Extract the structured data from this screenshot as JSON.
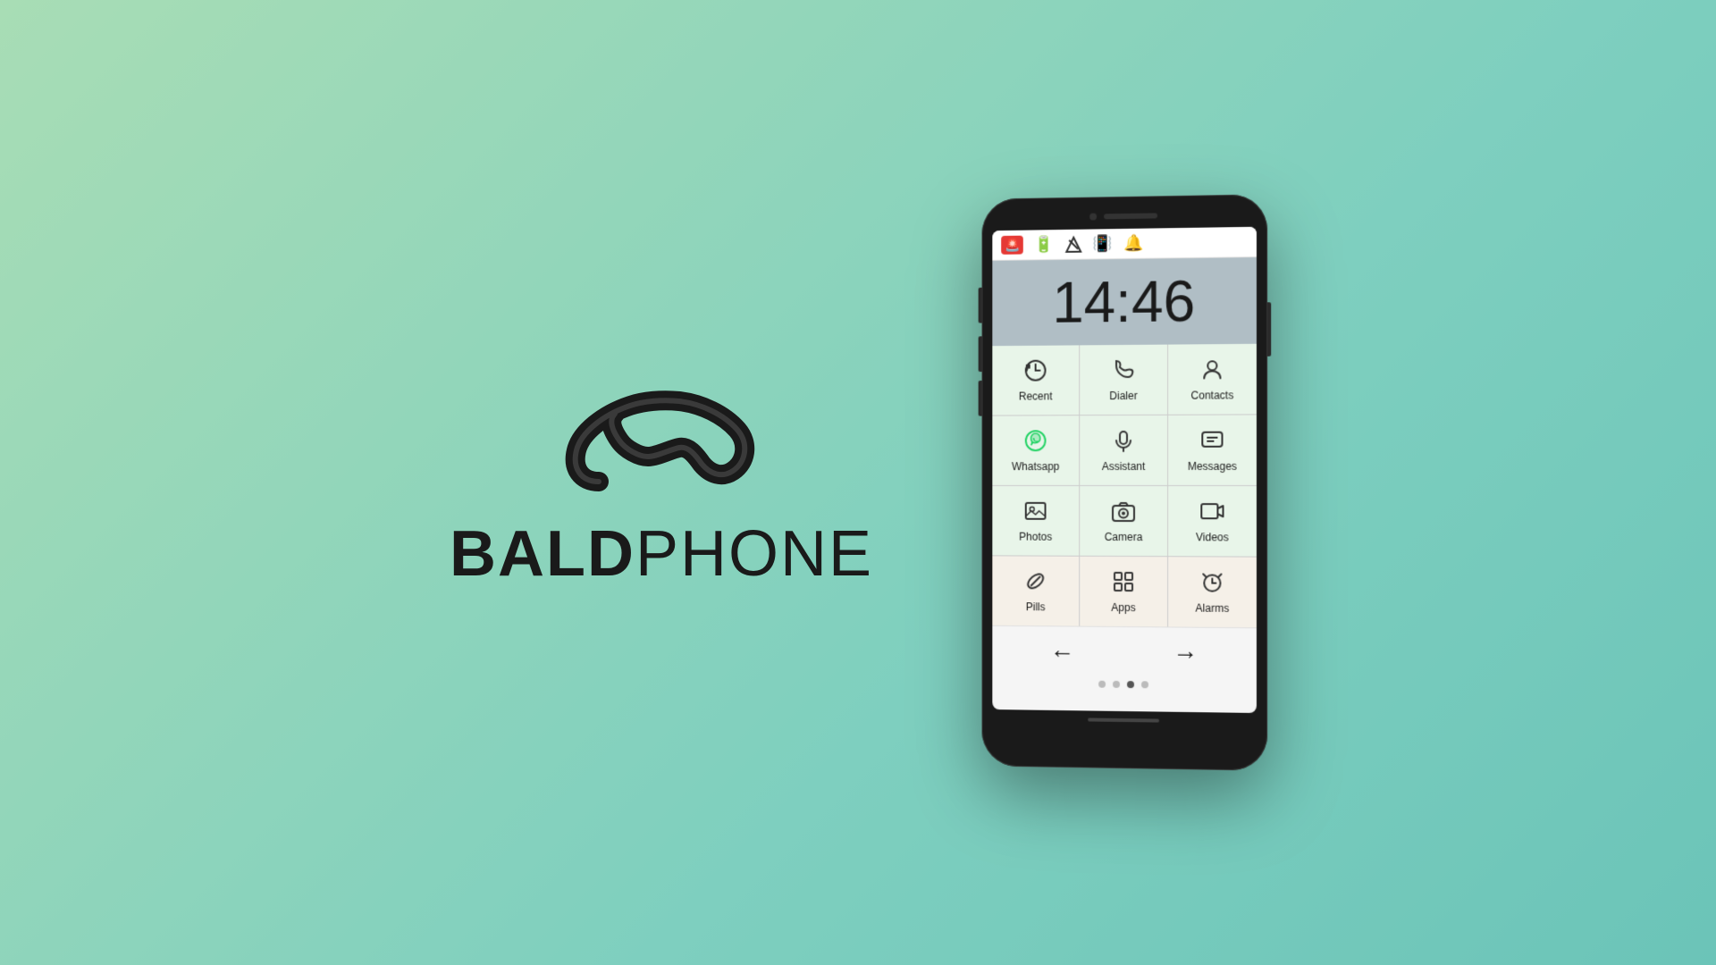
{
  "brand": {
    "bold": "BALD",
    "light": "PHONE"
  },
  "clock": {
    "time": "14:46"
  },
  "status_icons": [
    {
      "name": "sos-alarm",
      "symbol": "🚨"
    },
    {
      "name": "battery",
      "symbol": "🔋"
    },
    {
      "name": "no-signal",
      "symbol": "📵"
    },
    {
      "name": "vibrate",
      "symbol": "📳"
    },
    {
      "name": "bell",
      "symbol": "🔔"
    }
  ],
  "apps": [
    {
      "id": "recent",
      "label": "Recent",
      "icon": "🕐",
      "style": "green"
    },
    {
      "id": "dialer",
      "label": "Dialer",
      "icon": "📞",
      "style": "green"
    },
    {
      "id": "contacts",
      "label": "Contacts",
      "icon": "👤",
      "style": "green"
    },
    {
      "id": "whatsapp",
      "label": "Whatsapp",
      "icon": "💬",
      "style": "green"
    },
    {
      "id": "assistant",
      "label": "Assistant",
      "icon": "🎙️",
      "style": "green"
    },
    {
      "id": "messages",
      "label": "Messages",
      "icon": "💬",
      "style": "green"
    },
    {
      "id": "photos",
      "label": "Photos",
      "icon": "🖼️",
      "style": "green"
    },
    {
      "id": "camera",
      "label": "Camera",
      "icon": "📷",
      "style": "green"
    },
    {
      "id": "videos",
      "label": "Videos",
      "icon": "🎬",
      "style": "green"
    },
    {
      "id": "pills",
      "label": "Pills",
      "icon": "💊",
      "style": "beige"
    },
    {
      "id": "apps",
      "label": "Apps",
      "icon": "⊞",
      "style": "beige"
    },
    {
      "id": "alarms",
      "label": "Alarms",
      "icon": "⏰",
      "style": "beige"
    }
  ],
  "nav": {
    "back_arrow": "←",
    "forward_arrow": "→"
  },
  "dots": [
    {
      "active": false
    },
    {
      "active": false
    },
    {
      "active": true
    },
    {
      "active": false
    }
  ]
}
